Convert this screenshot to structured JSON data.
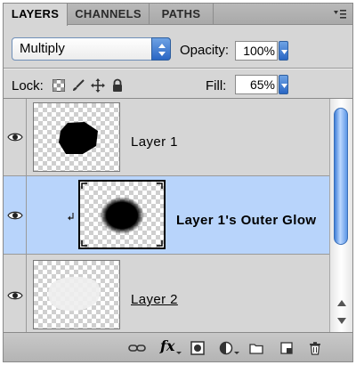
{
  "tabs": [
    {
      "label": "LAYERS",
      "active": true
    },
    {
      "label": "CHANNELS",
      "active": false
    },
    {
      "label": "PATHS",
      "active": false
    }
  ],
  "blend": {
    "mode": "Multiply",
    "opacity_label": "Opacity:",
    "opacity_value": "100%"
  },
  "lock": {
    "label": "Lock:",
    "fill_label": "Fill:",
    "fill_value": "65%"
  },
  "layers": [
    {
      "name": "Layer 1",
      "visible": true,
      "selected": false
    },
    {
      "name": "Layer 1's Outer Glow",
      "visible": true,
      "selected": true,
      "clipped": true
    },
    {
      "name": "Layer 2",
      "visible": true,
      "selected": false
    }
  ],
  "toolbar": {
    "fx_label": "fx"
  },
  "colors": {
    "selection": "#b8d4fb",
    "accent": "#3f7fd8",
    "panel": "#d6d6d6"
  },
  "icons": [
    "link-icon",
    "fx-icon",
    "mask-icon",
    "adjustment-icon",
    "folder-icon",
    "new-layer-icon",
    "trash-icon"
  ]
}
